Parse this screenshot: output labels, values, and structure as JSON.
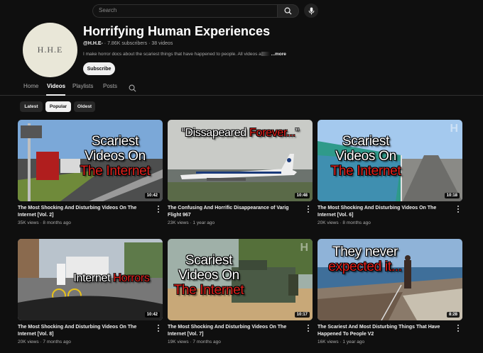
{
  "search": {
    "placeholder": "Search"
  },
  "channel": {
    "avatar_text": "H.H.E",
    "name": "Horrifying Human Experiences",
    "handle": "@H.H.E-",
    "sep1": "·",
    "subscribers": "7.86K subscribers",
    "sep2": "·",
    "videos_count": "38 videos",
    "description": "I make horror docs about the scariest things that have happened to people. All videos a",
    "more_label": "...more",
    "subscribe_label": "Subscribe"
  },
  "tabs": [
    {
      "label": "Home"
    },
    {
      "label": "Videos",
      "active": true
    },
    {
      "label": "Playlists"
    },
    {
      "label": "Posts"
    }
  ],
  "chips": [
    {
      "label": "Latest"
    },
    {
      "label": "Popular",
      "active": true
    },
    {
      "label": "Oldest"
    }
  ],
  "colors": {
    "background": "#0f0f0f",
    "accent_red": "#e0201c",
    "chip_bg": "#272727"
  },
  "videos": [
    {
      "title": "The Most Shocking And Disturbing Videos On The Internet [Vol. 2]",
      "views": "35K views",
      "age": "8 months ago",
      "duration": "10:42",
      "thumb_lines": [
        "Scariest",
        "Videos On",
        "The Internet"
      ]
    },
    {
      "title": "The Confusing And Horrific Disappearance of Varig Flight 967",
      "views": "23K views",
      "age": "1 year ago",
      "duration": "10:48",
      "thumb_quote_a": "“Dissapeared ",
      "thumb_quote_b": "Forever...",
      "thumb_quote_c": "”"
    },
    {
      "title": "The Most Shocking And Disturbing Videos On The Internet [Vol. 6]",
      "views": "20K views",
      "age": "8 months ago",
      "duration": "10:18",
      "thumb_lines": [
        "Scariest",
        "Videos On",
        "The Internet"
      ],
      "watermark": "H"
    },
    {
      "title": "The Most Shocking And Disturbing Videos On The Internet [Vol. 8]",
      "views": "20K views",
      "age": "7 months ago",
      "duration": "10:42",
      "thumb_line_a": "Internet ",
      "thumb_line_b": "Horrors"
    },
    {
      "title": "The Most Shocking And Disturbing Videos On The Internet [Vol. 7]",
      "views": "19K views",
      "age": "7 months ago",
      "duration": "10:17",
      "thumb_lines": [
        "Scariest",
        "Videos On",
        "The Internet"
      ],
      "watermark": "H"
    },
    {
      "title": "The Scariest And Most Disturbing Things That Have Happened To People V2",
      "views": "16K views",
      "age": "1 year ago",
      "duration": "8:28",
      "thumb_lines": [
        "They never",
        "expected it..."
      ]
    }
  ],
  "meta_sep": "·",
  "icons": {
    "search": "search-icon",
    "mic": "mic-icon",
    "tab_search": "search-icon",
    "more": "kebab-icon"
  }
}
